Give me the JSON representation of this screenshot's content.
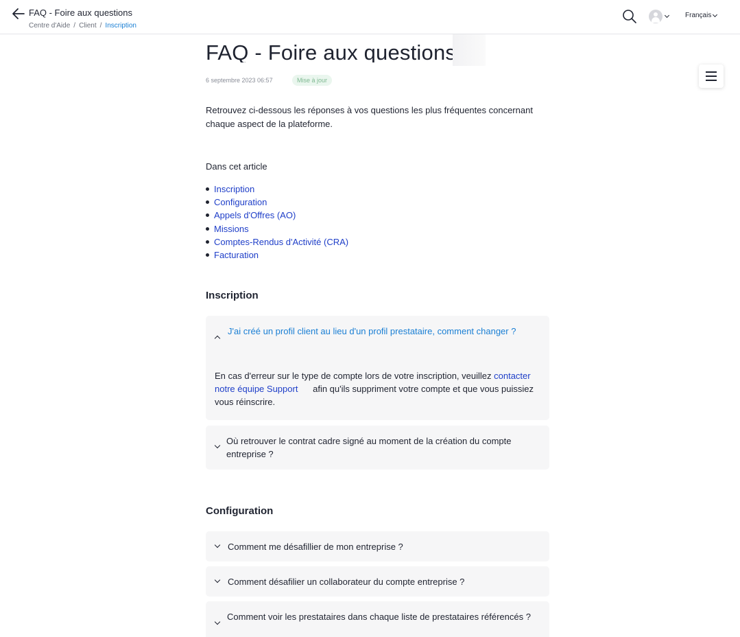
{
  "header": {
    "title": "FAQ - Foire aux questions",
    "breadcrumb": [
      "Centre d'Aide",
      "Client",
      "Inscription"
    ],
    "language": "Français"
  },
  "article": {
    "title": "FAQ - Foire aux questions",
    "date": "6 septembre 2023 06:57",
    "badge": "Mise à jour",
    "intro": "Retrouvez ci-dessous les réponses à vos questions les plus fréquentes concernant chaque aspect de la plateforme.",
    "toc_heading": "Dans cet article",
    "toc": [
      "Inscription",
      "Configuration",
      "Appels d'Offres (AO)",
      "Missions",
      "Comptes-Rendus d'Activité (CRA)",
      "Facturation"
    ]
  },
  "sections": {
    "inscription": {
      "title": "Inscription",
      "faq1": {
        "question": "J'ai créé un profil client au lieu d'un profil prestataire, comment changer ?",
        "answer_before": "En cas d'erreur sur le type de compte lors de votre inscription, veuillez ",
        "answer_link": "contacter notre équipe Support",
        "answer_after": "      afin qu'ils suppriment votre compte et que vous puissiez vous réinscrire."
      },
      "faq2": {
        "question": "Où retrouver le contrat cadre signé au moment de la création du compte entreprise ?"
      }
    },
    "configuration": {
      "title": "Configuration",
      "faq1": {
        "question": "Comment me désafillier de mon entreprise ?"
      },
      "faq2": {
        "question": "Comment désafilier un collaborateur du compte entreprise ?"
      },
      "faq3": {
        "question": "Comment voir les prestataires dans chaque liste de prestataires référencés ?"
      }
    }
  },
  "colors": {
    "link": "#1e3ec8",
    "accent": "#1a7fd4",
    "badge_text": "#7fb992",
    "card_bg": "#f6f6f7"
  },
  "icons": [
    "back-arrow-icon",
    "search-icon",
    "avatar-icon",
    "chevron-down-icon",
    "menu-icon",
    "chevron-up-icon"
  ]
}
